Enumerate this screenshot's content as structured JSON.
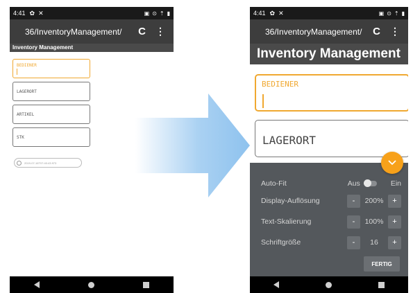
{
  "status_bar": {
    "time": "4:41",
    "icons": [
      "settings-icon",
      "tools-icon",
      "cast-icon",
      "vpn-icon",
      "wifi-icon",
      "battery-icon"
    ]
  },
  "url_bar": {
    "url": "36/InventoryManagement/",
    "reload_icon": "reload-icon",
    "menu_icon": "more-vert-icon"
  },
  "app": {
    "title": "Inventory Management"
  },
  "fields": [
    {
      "label": "BEDIENER",
      "active": true
    },
    {
      "label": "LAGERORT",
      "active": false
    },
    {
      "label": "ARTIKEL",
      "active": false
    },
    {
      "label": "STK",
      "active": false
    }
  ],
  "timestamp": "2019-07-16T07:40:43.973",
  "settings_panel": {
    "auto_fit": {
      "label": "Auto-Fit",
      "off_label": "Aus",
      "on_label": "Ein",
      "enabled": false
    },
    "display_resolution": {
      "label": "Display-Auflösung",
      "value": "200%"
    },
    "text_scaling": {
      "label": "Text-Skalierung",
      "value": "100%"
    },
    "font_size": {
      "label": "Schriftgröße",
      "value": "16"
    },
    "minus_label": "-",
    "plus_label": "+",
    "done_label": "FERTIG"
  },
  "colors": {
    "accent": "#f7a11a",
    "field_active": "#f0a830",
    "panel": "#54585c",
    "arrow": "#8ec2ee"
  }
}
